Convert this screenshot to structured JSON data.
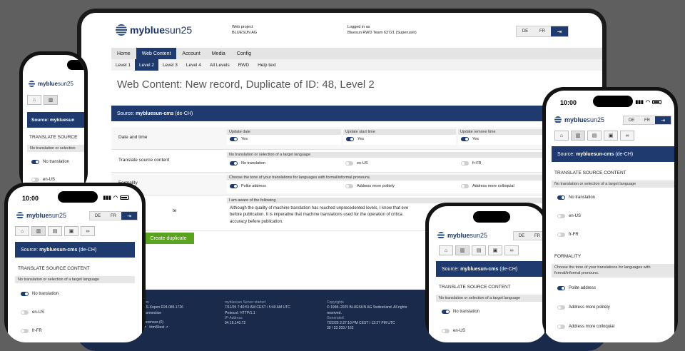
{
  "main": {
    "logo_bold": "myblue",
    "logo_light": "sun25",
    "project_label": "Web project",
    "project_value": "BLUESUN AG",
    "logged_label": "Logged in as",
    "logged_value": "Bluesun RWD Team 63721 (Superuser)",
    "lang_de": "DE",
    "lang_fr": "FR",
    "exit_icon": "logout-icon",
    "menu": [
      "Home",
      "Web Content",
      "Account",
      "Media",
      "Config"
    ],
    "menu_active": 1,
    "submenu": [
      "Level 1",
      "Level 2",
      "Level 3",
      "Level 4",
      "All Levels",
      "RWD",
      "Help text"
    ],
    "submenu_active": 1,
    "title": "Web Content: New record, Duplicate of ID: 48, Level 2",
    "source_label": "Source:",
    "source_name": "mybluesun-cms",
    "source_lang": "(de-CH)",
    "rows": {
      "date_label": "Date and time",
      "update_date": "Update date",
      "update_start": "Update start time",
      "update_remove": "Update remove time",
      "yes": "Yes",
      "translate_label": "Translate source content",
      "translate_caption": "No translation or selection of a target language",
      "no_translation": "No translation",
      "en_us": "en-US",
      "fr_fr": "fr-FR",
      "formality_label": "Formality",
      "formality_caption": "Choose the tone of your translations for languages with formal/informal pronouns.",
      "polite": "Polite address",
      "more_polite": "Address more politely",
      "more_colloquial": "Address more colloquial",
      "aware_caption": "I am aware of the following",
      "aware_label_tail": "te",
      "aware_text_1": "Although the quality of machine translation has reached unprecedented levels, I know that eve",
      "aware_text_2": "before publication. It is imperative that machine translations used for the operation of critica",
      "aware_text_3": "accuracy before publication."
    },
    "create_button": "Create duplicate",
    "footer": {
      "c1_h": "rsion",
      "c1_l1": "SES-Xopen R24.085.1726",
      "c1_l2": "L connection",
      "c1_l3": "references (0)",
      "c1_l4": "r",
      "c1_l5": "htmlStest",
      "c2_h": "mybluesun Server started",
      "c2_l1": "7/11/25 7:40:51 AM CEST / 5:40 AM UTC",
      "c2_l2": "Protocol: HTTP/1.1",
      "c2_h2": "IP-Address",
      "c2_l3": "94.16.140.72",
      "c3_h": "Copyrights",
      "c3_l1": "© 1998–2025 BLUESUN AG Switzerland. All rights",
      "c3_l2": "reserved.",
      "c3_h2": "Generated",
      "c3_l3": "7/22/25 2:27:10 PM CEST / 12:27 PM UTC",
      "c3_l4": "30 / 23  203 / 162"
    }
  },
  "phone": {
    "time": "10:00",
    "logo_bold": "myblue",
    "logo_light": "sun25",
    "lang_de": "DE",
    "lang_fr": "FR",
    "tab_icons": [
      "home-icon",
      "book-icon",
      "document-icon",
      "image-icon",
      "link-icon"
    ],
    "source_label": "Source:",
    "source_name": "mybluesun-cms",
    "source_lang": "(de-CH)",
    "translate_heading": "TRANSLATE SOURCE CONTENT",
    "translate_caption": "No translation or selection of a target language",
    "no_translation": "No translation",
    "en_us": "en-US",
    "fr_fr": "fr-FR",
    "formality_heading": "FORMALITY",
    "formality_caption_1": "Choose the tone of your translations for languages with",
    "formality_caption_2": "formal/informal pronouns.",
    "polite": "Polite address",
    "more_polite": "Address more politely",
    "more_colloquial": "Address more colloquial",
    "tl_source_short": "Source: mybluesun",
    "tl_translate_short": "TRANSLATE SOURCE",
    "tl_caption_short": "No translation or selection",
    "tl_no_translation_short": "No translation",
    "tl_en_short": "en-US"
  },
  "colors": {
    "navy": "#1e3a6e",
    "green": "#5aa31f",
    "footer": "#1a2a4a"
  }
}
